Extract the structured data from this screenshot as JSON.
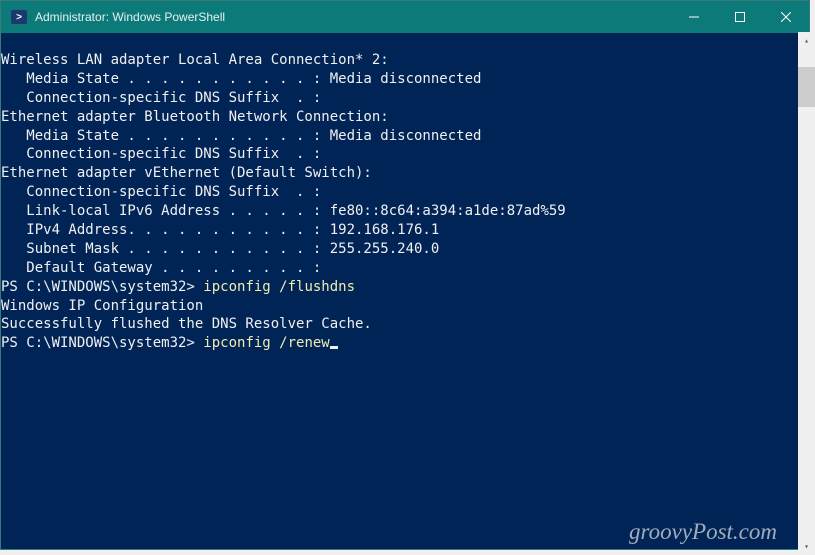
{
  "titlebar": {
    "title": "Administrator: Windows PowerShell"
  },
  "terminal": {
    "lines": [
      "Wireless LAN adapter Local Area Connection* 2:",
      "",
      "   Media State . . . . . . . . . . . : Media disconnected",
      "   Connection-specific DNS Suffix  . :",
      "",
      "Ethernet adapter Bluetooth Network Connection:",
      "",
      "   Media State . . . . . . . . . . . : Media disconnected",
      "   Connection-specific DNS Suffix  . :",
      "",
      "Ethernet adapter vEthernet (Default Switch):",
      "",
      "   Connection-specific DNS Suffix  . :",
      "   Link-local IPv6 Address . . . . . : fe80::8c64:a394:a1de:87ad%59",
      "   IPv4 Address. . . . . . . . . . . : 192.168.176.1",
      "   Subnet Mask . . . . . . . . . . . : 255.255.240.0",
      "   Default Gateway . . . . . . . . . :"
    ],
    "prompt1_path": "PS C:\\WINDOWS\\system32> ",
    "prompt1_cmd": "ipconfig /flushdns",
    "after_prompt1": [
      "",
      "Windows IP Configuration",
      "",
      "Successfully flushed the DNS Resolver Cache."
    ],
    "prompt2_path": "PS C:\\WINDOWS\\system32> ",
    "prompt2_cmd": "ipconfig /renew"
  },
  "watermark": "groovyPost.com"
}
